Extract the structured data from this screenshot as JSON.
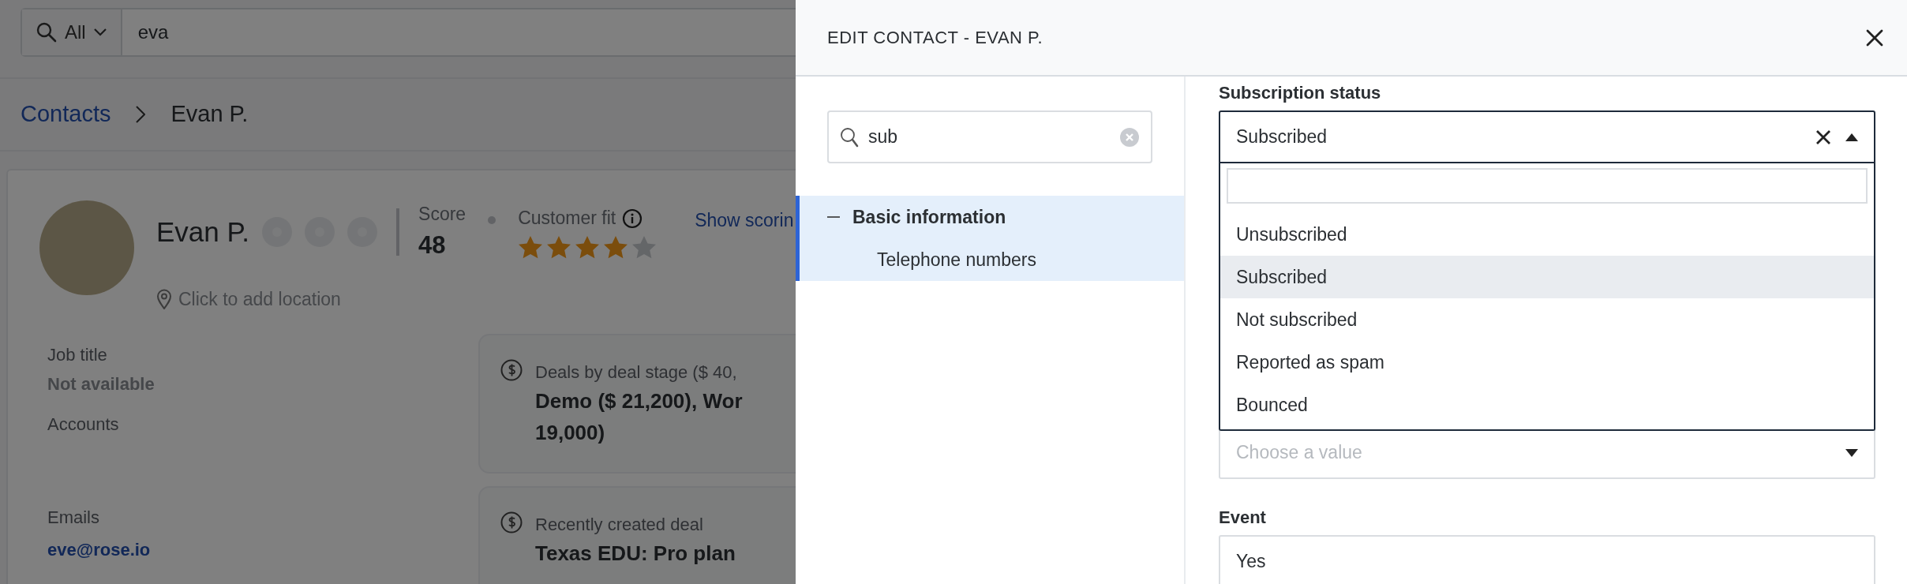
{
  "search_bar": {
    "scope": "All",
    "query": "eva"
  },
  "breadcrumb": [
    {
      "label": "Contacts",
      "kind": "link"
    },
    {
      "label": "Evan P.",
      "kind": "current"
    }
  ],
  "contact": {
    "name": "Evan P.",
    "score_label": "Score",
    "score": "48",
    "fit_label": "Customer fit",
    "stars": 4,
    "scoring_link": "Show scorin",
    "location_placeholder": "Click to add location"
  },
  "details": [
    {
      "label": "Job title",
      "value": "Not available",
      "kind": "muted"
    },
    {
      "label": "Accounts",
      "kind": "empty"
    },
    {
      "label": "Emails",
      "value": "eve@rose.io",
      "kind": "link"
    }
  ],
  "summary_cards": [
    {
      "title": "Deals by deal stage ($ 40,",
      "lines": [
        "Demo ($ 21,200), Wor",
        "19,000)"
      ]
    },
    {
      "title": "Recently created deal",
      "lines": [
        "Texas EDU: Pro plan"
      ]
    }
  ],
  "panel": {
    "title": "EDIT CONTACT - EVAN P.",
    "search": {
      "value": "sub"
    },
    "tree": [
      {
        "label": "Basic information",
        "expanded": true,
        "selected": true,
        "children": [
          {
            "label": "Telephone numbers"
          }
        ]
      }
    ]
  },
  "form": {
    "fields": [
      {
        "kind": "select",
        "label": "Subscription status",
        "value": "Subscribed",
        "open": true,
        "options": [
          {
            "label": "Unsubscribed",
            "selected": false
          },
          {
            "label": "Subscribed",
            "selected": true
          },
          {
            "label": "Not subscribed",
            "selected": false
          },
          {
            "label": "Reported as spam",
            "selected": false
          },
          {
            "label": "Bounced",
            "selected": false
          }
        ]
      },
      {
        "kind": "select",
        "placeholder": "Choose a value",
        "open": false
      },
      {
        "kind": "text",
        "label": "Event",
        "value": "Yes"
      }
    ]
  }
}
